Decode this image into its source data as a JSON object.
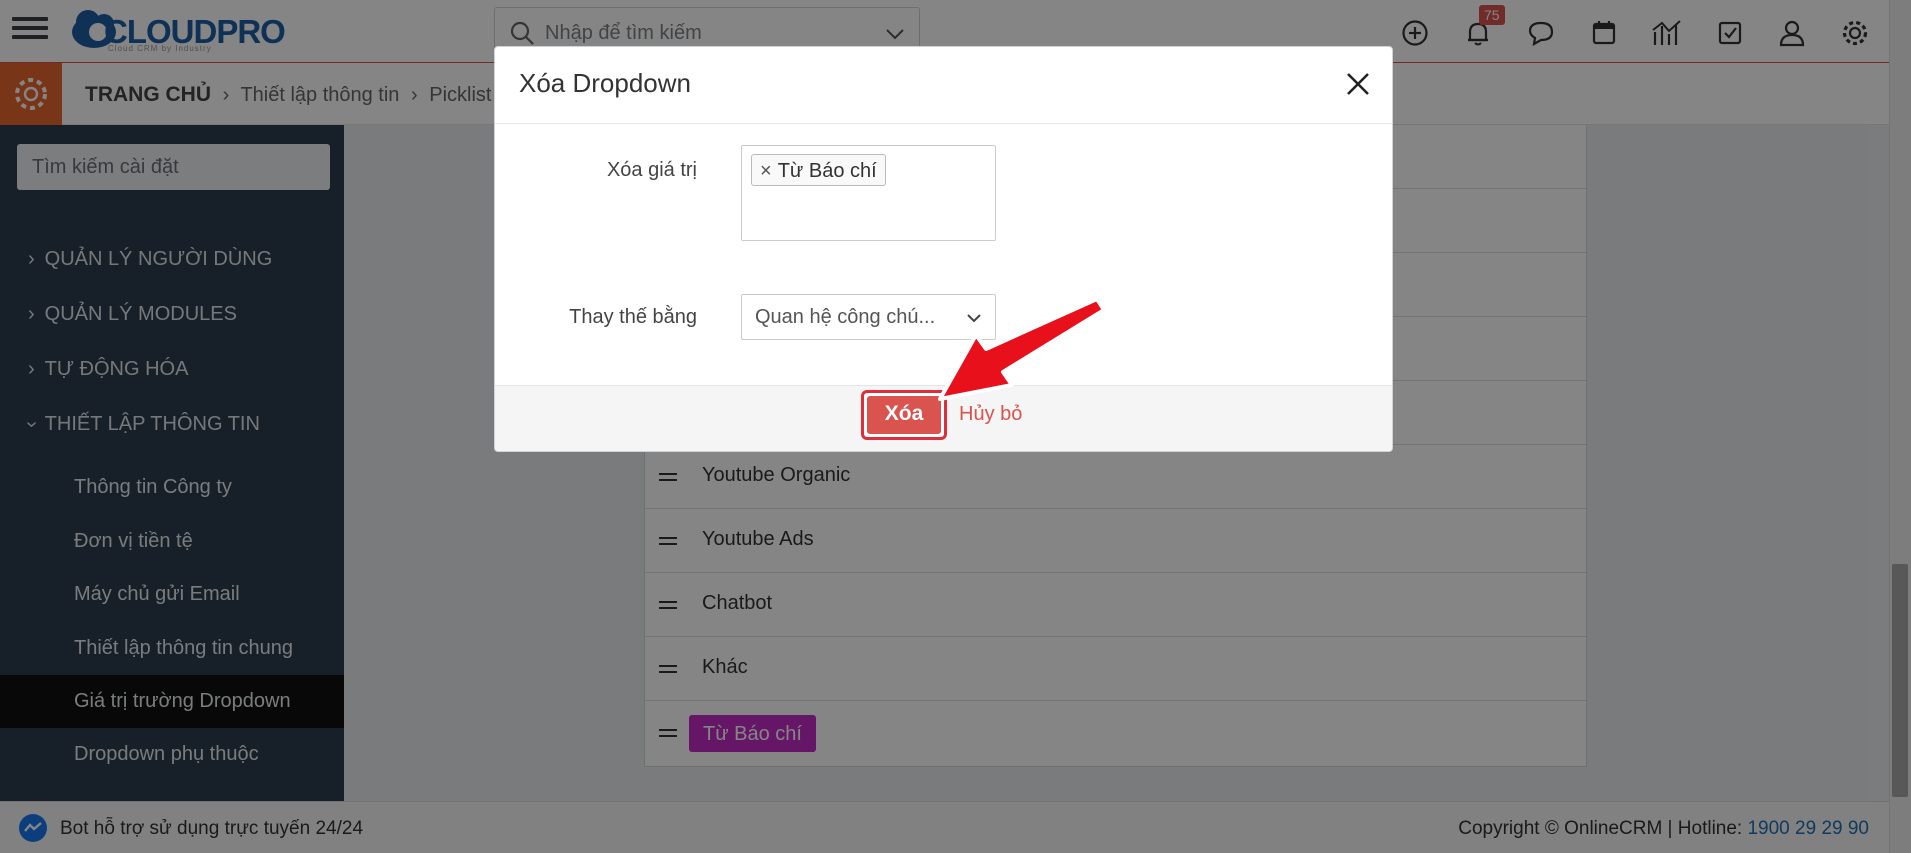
{
  "header": {
    "logo_text": "CLOUDPRO",
    "logo_tagline": "Cloud CRM by Industry",
    "search_placeholder": "Nhập để tìm kiếm",
    "notification_count": "75"
  },
  "breadcrumb": {
    "home": "TRANG CHỦ",
    "level1": "Thiết lập thông tin",
    "level2": "Picklist"
  },
  "sidebar": {
    "search_placeholder": "Tìm kiếm cài đặt",
    "sections": [
      {
        "label": "QUẢN LÝ NGƯỜI DÙNG"
      },
      {
        "label": "QUẢN LÝ MODULES"
      },
      {
        "label": "TỰ ĐỘNG HÓA"
      },
      {
        "label": "THIẾT LẬP THÔNG TIN"
      }
    ],
    "items": [
      {
        "label": "Thông tin Công ty"
      },
      {
        "label": "Đơn vị tiền tệ"
      },
      {
        "label": "Máy chủ gửi Email"
      },
      {
        "label": "Thiết lập thông tin chung"
      },
      {
        "label": "Giá trị trường Dropdown"
      },
      {
        "label": "Dropdown phụ thuộc"
      }
    ]
  },
  "picklist": {
    "rows": [
      {
        "label": "Youtube Organic"
      },
      {
        "label": "Youtube Ads"
      },
      {
        "label": "Chatbot"
      },
      {
        "label": "Khác"
      },
      {
        "label": "Từ Báo chí"
      }
    ]
  },
  "modal": {
    "title": "Xóa Dropdown",
    "delete_value_label": "Xóa giá trị",
    "delete_value_chip": "Từ Báo chí",
    "replace_label": "Thay thế bằng",
    "replace_selected": "Quan hệ công chú...",
    "delete_button": "Xóa",
    "cancel_link": "Hủy bỏ"
  },
  "footer": {
    "support_text": "Bot hỗ trợ sử dụng trực tuyến 24/24",
    "copyright": "Copyright © OnlineCRM | Hotline: ",
    "hotline": "1900 29 29 90"
  },
  "colors": {
    "accent_orange": "#e8672e",
    "sidebar_bg": "#2c3e50",
    "danger": "#d9534f",
    "badge_purple": "#c12bc4",
    "arrow_red": "#e8101a"
  }
}
